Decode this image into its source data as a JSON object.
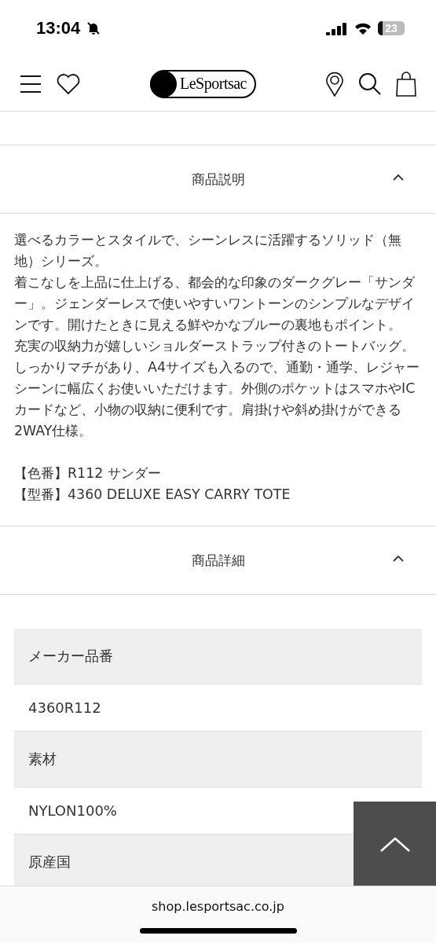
{
  "status_bar": {
    "time": "13:04",
    "silent": true,
    "battery": "23"
  },
  "header": {
    "logo": "LeSportsac"
  },
  "sections": [
    {
      "title": "商品説明",
      "expanded": true,
      "kind": "text",
      "paragraphs": [
        "選べるカラーとスタイルで、シーンレスに活躍するソリッド（無地）シリーズ。",
        "着こなしを上品に仕上げる、都会的な印象のダークグレー「サンダー」。ジェンダーレスで使いやすいワントーンのシンプルなデザインです。開けたときに見える鮮やかなブルーの裏地もポイント。",
        "充実の収納力が嬉しいショルダーストラップ付きのトートバッグ。しっかりマチがあり、A4サイズも入るので、通勤・通学、レジャーシーンに幅広くお使いいただけます。外側のポケットはスマホやICカードなど、小物の収納に便利です。肩掛けや斜め掛けができる2WAY仕様。"
      ],
      "specs": [
        "【色番】R112 サンダー",
        "【型番】4360 DELUXE EASY CARRY TOTE"
      ]
    },
    {
      "title": "商品詳細",
      "expanded": true,
      "kind": "table",
      "rows": [
        {
          "label": "メーカー品番",
          "value": "4360R112"
        },
        {
          "label": "素材",
          "value": "NYLON100%"
        },
        {
          "label": "原産国"
        }
      ]
    }
  ],
  "browser": {
    "url": "shop.lesportsac.co.jp"
  }
}
